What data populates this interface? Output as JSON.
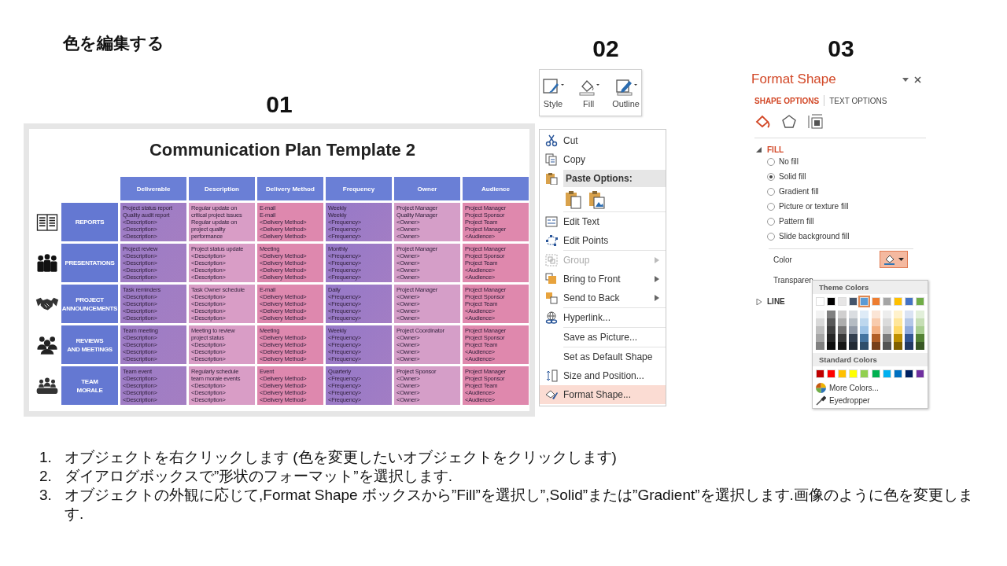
{
  "heading": "色を編集する",
  "template": {
    "label": "01",
    "title": "Communication Plan Template 2",
    "columns": [
      "Deliverable",
      "Description",
      "Delivery Method",
      "Frequency",
      "Owner",
      "Audience"
    ],
    "rows": [
      {
        "header": "REPORTS",
        "cells": [
          [
            "Project status report",
            "Quality audit report",
            "<Description>",
            "<Description>",
            "<Description>"
          ],
          [
            "Regular update on",
            "critical project issues",
            "Regular update on",
            "project quality",
            "performance"
          ],
          [
            "E-mail",
            "E-mail",
            "<Delivery Method>",
            "<Delivery Method>",
            "<Delivery Method>"
          ],
          [
            "Weekly",
            "Weekly",
            "<Frequency>",
            "<Frequency>",
            "<Frequency>"
          ],
          [
            "Project Manager",
            "Quality Manager",
            "<Owner>",
            "<Owner>",
            "<Owner>"
          ],
          [
            "Project Manager",
            "Project Sponsor",
            "Project Team",
            "Project Manager",
            "<Audience>"
          ]
        ]
      },
      {
        "header": "PRESENTATIONS",
        "cells": [
          [
            "Project review",
            "<Description>",
            "<Description>",
            "<Description>",
            "<Description>"
          ],
          [
            "Project status update",
            "<Description>",
            "<Description>",
            "<Description>",
            "<Description>"
          ],
          [
            "Meeting",
            "<Delivery Method>",
            "<Delivery Method>",
            "<Delivery Method>",
            "<Delivery Method>"
          ],
          [
            "Monthly",
            "<Frequency>",
            "<Frequency>",
            "<Frequency>",
            "<Frequency>"
          ],
          [
            "Project Manager",
            "<Owner>",
            "<Owner>",
            "<Owner>",
            "<Owner>"
          ],
          [
            "Project Manager",
            "Project Sponsor",
            "Project Team",
            "<Audience>",
            "<Audience>"
          ]
        ]
      },
      {
        "header": "PROJECT\nANNOUNCEMENTS",
        "cells": [
          [
            "Task reminders",
            "<Description>",
            "<Description>",
            "<Description>",
            "<Description>"
          ],
          [
            "Task Owner schedule",
            "<Description>",
            "<Description>",
            "<Description>",
            "<Description>"
          ],
          [
            "E-mail",
            "<Delivery Method>",
            "<Delivery Method>",
            "<Delivery Method>",
            "<Delivery Method>"
          ],
          [
            "Daily",
            "<Frequency>",
            "<Frequency>",
            "<Frequency>",
            "<Frequency>"
          ],
          [
            "Project Manager",
            "<Owner>",
            "<Owner>",
            "<Owner>",
            "<Owner>"
          ],
          [
            "Project Manager",
            "Project Sponsor",
            "Project Team",
            "<Audience>",
            "<Audience>"
          ]
        ]
      },
      {
        "header": "REVIEWS\nAND MEETINGS",
        "cells": [
          [
            "Team meeting",
            "<Description>",
            "<Description>",
            "<Description>",
            "<Description>"
          ],
          [
            "Meeting to review",
            "project status",
            "<Description>",
            "<Description>",
            "<Description>"
          ],
          [
            "Meeting",
            "<Delivery Method>",
            "<Delivery Method>",
            "<Delivery Method>",
            "<Delivery Method>"
          ],
          [
            "Weekly",
            "<Frequency>",
            "<Frequency>",
            "<Frequency>",
            "<Frequency>"
          ],
          [
            "Project Coordinator",
            "<Owner>",
            "<Owner>",
            "<Owner>",
            "<Owner>"
          ],
          [
            "Project Manager",
            "Project Sponsor",
            "Project Team",
            "<Audience>",
            "<Audience>"
          ]
        ]
      },
      {
        "header": "TEAM\nMORALE",
        "cells": [
          [
            "Team event",
            "<Description>",
            "<Description>",
            "<Description>",
            "<Description>"
          ],
          [
            "Regularly schedule",
            "team morale events",
            "<Description>",
            "<Description>",
            "<Description>"
          ],
          [
            "Event",
            "<Delivery Method>",
            "<Delivery Method>",
            "<Delivery Method>",
            "<Delivery Method>"
          ],
          [
            "Quarterly",
            "<Frequency>",
            "<Frequency>",
            "<Frequency>",
            "<Frequency>"
          ],
          [
            "Project Sponsor",
            "<Owner>",
            "<Owner>",
            "<Owner>",
            "<Owner>"
          ],
          [
            "Project Manager",
            "Project Sponsor",
            "Project Team",
            "<Audience>",
            "<Audience>"
          ]
        ]
      }
    ]
  },
  "context_panel": {
    "label": "02",
    "toolbar": [
      "Style",
      "Fill",
      "Outline"
    ],
    "menu": [
      {
        "kind": "item",
        "label": "Cut",
        "selected": false,
        "disabled": false,
        "submenu": false
      },
      {
        "kind": "item",
        "label": "Copy",
        "selected": false,
        "disabled": false,
        "submenu": false
      },
      {
        "kind": "header",
        "label": "Paste Options:"
      },
      {
        "kind": "paste_icons"
      },
      {
        "kind": "separator"
      },
      {
        "kind": "item",
        "label": "Edit Text",
        "selected": false,
        "disabled": false,
        "submenu": false
      },
      {
        "kind": "item",
        "label": "Edit Points",
        "selected": false,
        "disabled": false,
        "submenu": false
      },
      {
        "kind": "separator"
      },
      {
        "kind": "item",
        "label": "Group",
        "selected": false,
        "disabled": true,
        "submenu": true
      },
      {
        "kind": "item",
        "label": "Bring to Front",
        "selected": false,
        "disabled": false,
        "submenu": true
      },
      {
        "kind": "item",
        "label": "Send to Back",
        "selected": false,
        "disabled": false,
        "submenu": true
      },
      {
        "kind": "separator"
      },
      {
        "kind": "item",
        "label": "Hyperlink...",
        "selected": false,
        "disabled": false,
        "submenu": false
      },
      {
        "kind": "separator"
      },
      {
        "kind": "item",
        "label": "Save as Picture...",
        "selected": false,
        "disabled": false,
        "submenu": false
      },
      {
        "kind": "separator"
      },
      {
        "kind": "item",
        "label": "Set as Default Shape",
        "selected": false,
        "disabled": false,
        "submenu": false
      },
      {
        "kind": "item",
        "label": "Size and Position...",
        "selected": false,
        "disabled": false,
        "submenu": false
      },
      {
        "kind": "item",
        "label": "Format Shape...",
        "selected": true,
        "disabled": false,
        "submenu": false
      }
    ]
  },
  "format_pane": {
    "label": "03",
    "title": "Format Shape",
    "tabs": [
      {
        "label": "SHAPE OPTIONS",
        "selected": true
      },
      {
        "label": "TEXT OPTIONS",
        "selected": false
      }
    ],
    "category_icons": [
      {
        "selected": true
      },
      {
        "selected": false
      },
      {
        "selected": false
      }
    ],
    "fill_section": {
      "label": "FILL",
      "expanded": true,
      "options": [
        {
          "label": "No fill",
          "selected": false
        },
        {
          "label": "Solid fill",
          "selected": true
        },
        {
          "label": "Gradient fill",
          "selected": false
        },
        {
          "label": "Picture or texture fill",
          "selected": false
        },
        {
          "label": "Pattern fill",
          "selected": false
        },
        {
          "label": "Slide background fill",
          "selected": false
        }
      ],
      "color_label": "Color",
      "color_button_open": true,
      "transparency_label": "Transparen"
    },
    "line_section": {
      "label": "LINE",
      "expanded": false
    },
    "color_menu": {
      "theme_title": "Theme Colors",
      "theme_colors": [
        {
          "color": "#ffffff",
          "selected": false
        },
        {
          "color": "#000000",
          "selected": false
        },
        {
          "color": "#e7e6e6",
          "selected": false
        },
        {
          "color": "#44546a",
          "selected": false
        },
        {
          "color": "#5b9bd5",
          "selected": true
        },
        {
          "color": "#ed7d31",
          "selected": false
        },
        {
          "color": "#a5a5a5",
          "selected": false
        },
        {
          "color": "#ffc000",
          "selected": false
        },
        {
          "color": "#4472c4",
          "selected": false
        },
        {
          "color": "#70ad47",
          "selected": false
        }
      ],
      "standard_title": "Standard Colors",
      "standard_colors": [
        {
          "color": "#c00000",
          "selected": false
        },
        {
          "color": "#ff0000",
          "selected": false
        },
        {
          "color": "#ffc000",
          "selected": false
        },
        {
          "color": "#ffff00",
          "selected": false
        },
        {
          "color": "#92d050",
          "selected": false
        },
        {
          "color": "#00b050",
          "selected": false
        },
        {
          "color": "#00b0f0",
          "selected": false
        },
        {
          "color": "#0070c0",
          "selected": false
        },
        {
          "color": "#002060",
          "selected": false
        },
        {
          "color": "#7030a0",
          "selected": false
        }
      ],
      "more_colors": "More Colors...",
      "eyedropper": "Eyedropper"
    }
  },
  "steps": [
    {
      "number": "1.",
      "text": "オブジェクトを右クリックします (色を変更したいオブジェクトをクリックします)"
    },
    {
      "number": "2.",
      "text": "ダイアログボックスで”形状のフォーマット”を選択します."
    },
    {
      "number": "3.",
      "text": "オブジェクトの外観に応じて,Format Shape ボックスから”Fill”を選択し”,Solid”または”Gradient”を選択します.画像のように色を変更します."
    }
  ]
}
